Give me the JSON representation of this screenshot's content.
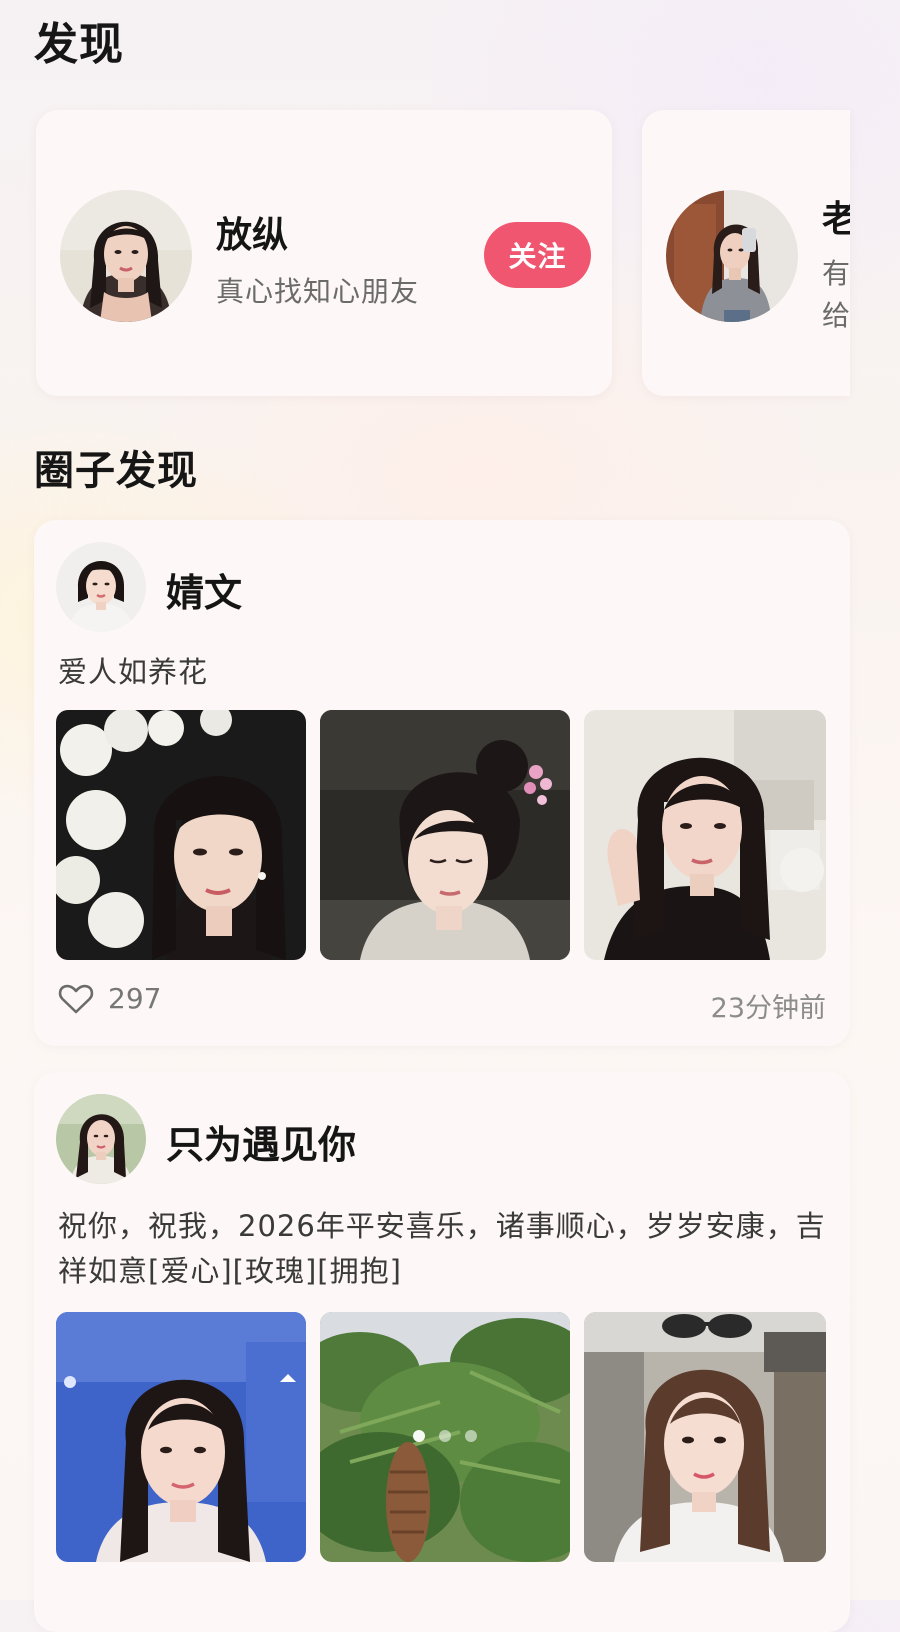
{
  "header": {
    "title": "发现"
  },
  "recommend": {
    "follow_label": "关注",
    "users": [
      {
        "name": "放纵",
        "desc": "真心找知心朋友"
      },
      {
        "name": "老",
        "desc_lines": [
          "有",
          "给"
        ]
      }
    ]
  },
  "circle": {
    "title": "圈子发现"
  },
  "posts": [
    {
      "author": "婧文",
      "text": "爱人如养花",
      "likes": "297",
      "time": "23分钟前"
    },
    {
      "author": "只为遇见你",
      "text": "祝你，祝我，2026年平安喜乐，诸事顺心，岁岁安康，吉祥如意[爱心][玫瑰][拥抱]",
      "carousel": {
        "total": 3,
        "active": 1
      }
    }
  ],
  "colors": {
    "accent": "#f0566f",
    "card_bg": "#fdf8f7",
    "text_secondary": "#6b6b6b"
  },
  "icons": {
    "like": "heart-outline-icon"
  }
}
